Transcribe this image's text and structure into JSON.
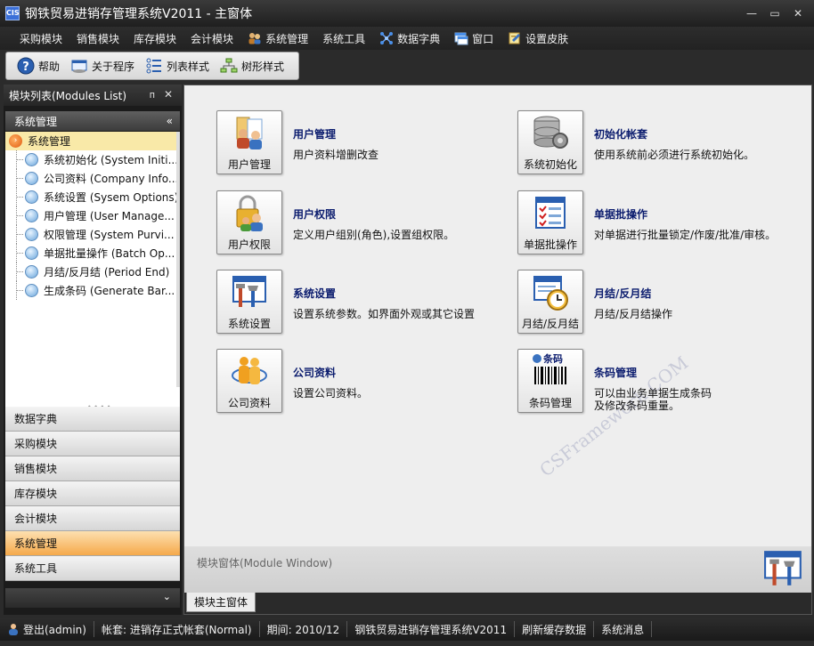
{
  "window": {
    "app_icon": "CIS",
    "title": "钢铁贸易进销存管理系统V2011 - 主窗体",
    "min": "—",
    "restore": "▭",
    "close": "✕"
  },
  "menubar": {
    "items": [
      {
        "label": "采购模块",
        "icon": ""
      },
      {
        "label": "销售模块",
        "icon": ""
      },
      {
        "label": "库存模块",
        "icon": ""
      },
      {
        "label": "会计模块",
        "icon": ""
      },
      {
        "label": "系统管理",
        "icon": "users-icon"
      },
      {
        "label": "系统工具",
        "icon": ""
      },
      {
        "label": "数据字典",
        "icon": "network-icon"
      },
      {
        "label": "窗口",
        "icon": "window-icon"
      },
      {
        "label": "设置皮肤",
        "icon": "skin-icon"
      }
    ]
  },
  "toolbar": {
    "help": "帮助",
    "about": "关于程序",
    "list_style": "列表样式",
    "tree_style": "树形样式"
  },
  "left_panel": {
    "header": "模块列表(Modules List)",
    "pin": "ᴨ",
    "close": "✕",
    "group_title": "系统管理",
    "group_chevron": "«",
    "tree_root": "系统管理",
    "tree_items": [
      "系统初始化 (System Initi...",
      "公司资料 (Company Info...",
      "系统设置 (Sysem Options)",
      "用户管理 (User Manage...",
      "权限管理 (System Purvi...",
      "单据批量操作 (Batch Op...",
      "月结/反月结 (Period End)",
      "生成条码 (Generate Bar..."
    ],
    "grip": "• • • •",
    "nav_groups": [
      "数据字典",
      "采购模块",
      "销售模块",
      "库存模块",
      "会计模块",
      "系统管理",
      "系统工具"
    ],
    "active_group": "系统管理",
    "more_chevron": "⌄"
  },
  "main": {
    "modules": [
      {
        "tile": "用户管理",
        "title": "用户管理",
        "desc": "用户资料增删改查"
      },
      {
        "tile": "用户权限",
        "title": "用户权限",
        "desc": "定义用户组别(角色),设置组权限。"
      },
      {
        "tile": "系统设置",
        "title": "系统设置",
        "desc": "设置系统参数。如界面外观或其它设置"
      },
      {
        "tile": "公司资料",
        "title": "公司资料",
        "desc": "设置公司资料。"
      },
      {
        "tile": "系统初始化",
        "title": "初始化帐套",
        "desc": "使用系统前必须进行系统初始化。"
      },
      {
        "tile": "单据批操作",
        "title": "单据批操作",
        "desc": "对单据进行批量锁定/作废/批准/审核。"
      },
      {
        "tile": "月结/反月结",
        "title": "月结/反月结",
        "desc": "月结/反月结操作"
      },
      {
        "tile": "条码管理",
        "title": "条码管理",
        "desc": "可以由业务单据生成条码\n及修改条码重量。"
      }
    ],
    "barcode_tile_caption": "条码",
    "watermark": "CSFramework.COM",
    "module_window_label": "模块窗体(Module Window)",
    "tab": "模块主窗体"
  },
  "statusbar": {
    "login": "登出(admin)",
    "account": "帐套: 进销存正式帐套(Normal)",
    "period": "期间: 2010/12",
    "system": "钢铁贸易进销存管理系统V2011",
    "refresh": "刷新缓存数据",
    "messages": "系统消息"
  }
}
